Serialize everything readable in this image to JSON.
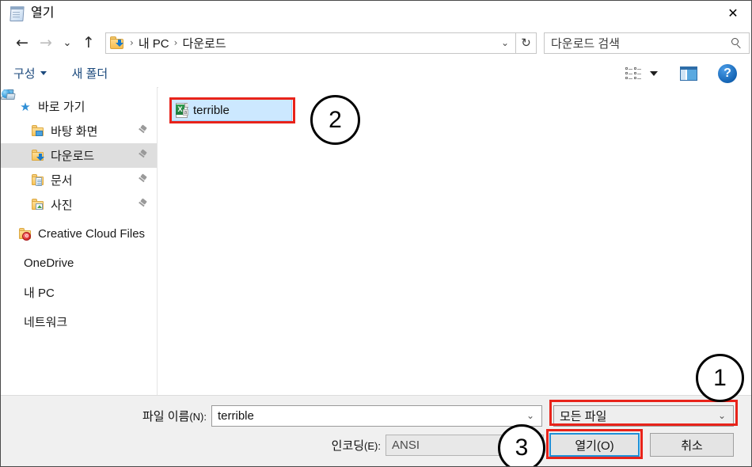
{
  "window": {
    "title": "열기",
    "title_icon": "notepad-icon",
    "close_label": "✕"
  },
  "nav": {
    "back": "←",
    "forward": "→",
    "history": "⌄",
    "up": "↑",
    "refresh": "↻",
    "address_chevron": "⌄",
    "breadcrumb": [
      {
        "label": "내 PC"
      },
      {
        "label": "다운로드"
      }
    ],
    "separator": "›"
  },
  "search": {
    "placeholder": "다운로드 검색",
    "icon": "search-icon"
  },
  "commandbar": {
    "organize": "구성",
    "new_folder": "새 폴더",
    "view_icon": "view-layout-icon",
    "preview_pane_icon": "preview-pane-icon",
    "help_label": "?"
  },
  "sidebar": {
    "items": [
      {
        "label": "바로 가기",
        "icon": "star-icon",
        "pinned": false,
        "selected": false,
        "indent": 0
      },
      {
        "label": "바탕 화면",
        "icon": "desktop-folder-icon",
        "pinned": true,
        "selected": false,
        "indent": 1
      },
      {
        "label": "다운로드",
        "icon": "downloads-folder-icon",
        "pinned": true,
        "selected": true,
        "indent": 1
      },
      {
        "label": "문서",
        "icon": "documents-folder-icon",
        "pinned": true,
        "selected": false,
        "indent": 1
      },
      {
        "label": "사진",
        "icon": "pictures-folder-icon",
        "pinned": true,
        "selected": false,
        "indent": 1
      },
      {
        "label": "Creative Cloud Files",
        "icon": "creative-cloud-icon",
        "pinned": false,
        "selected": false,
        "indent": 0
      },
      {
        "label": "OneDrive",
        "icon": "onedrive-cloud-icon",
        "pinned": false,
        "selected": false,
        "indent": 0
      },
      {
        "label": "내 PC",
        "icon": "this-pc-icon",
        "pinned": false,
        "selected": false,
        "indent": 0
      },
      {
        "label": "네트워크",
        "icon": "network-icon",
        "pinned": false,
        "selected": false,
        "indent": 0
      }
    ]
  },
  "filelist": {
    "items": [
      {
        "name": "terrible",
        "icon": "excel-file-icon",
        "icon_letter": "X",
        "icon_sub": "a",
        "selected": true
      }
    ]
  },
  "bottom": {
    "filename_label": "파일 이름",
    "filename_mnemonic": "(N):",
    "filename_value": "terrible",
    "filetype_value": "모든 파일",
    "encoding_label": "인코딩",
    "encoding_mnemonic": "(E):",
    "encoding_value": "ANSI",
    "open_button": "열기(O)",
    "cancel_button": "취소",
    "chevron": "⌄"
  },
  "annotations": {
    "markers": [
      {
        "number": "1",
        "target": "filetype-dropdown"
      },
      {
        "number": "2",
        "target": "file-item-terrible"
      },
      {
        "number": "3",
        "target": "open-button"
      }
    ]
  },
  "colors": {
    "annotation_red": "#e8231a",
    "annotation_black": "#000000",
    "selection_blue": "#cce8ff",
    "focus_blue": "#1e90d8",
    "link_blue": "#1c4a7d"
  }
}
